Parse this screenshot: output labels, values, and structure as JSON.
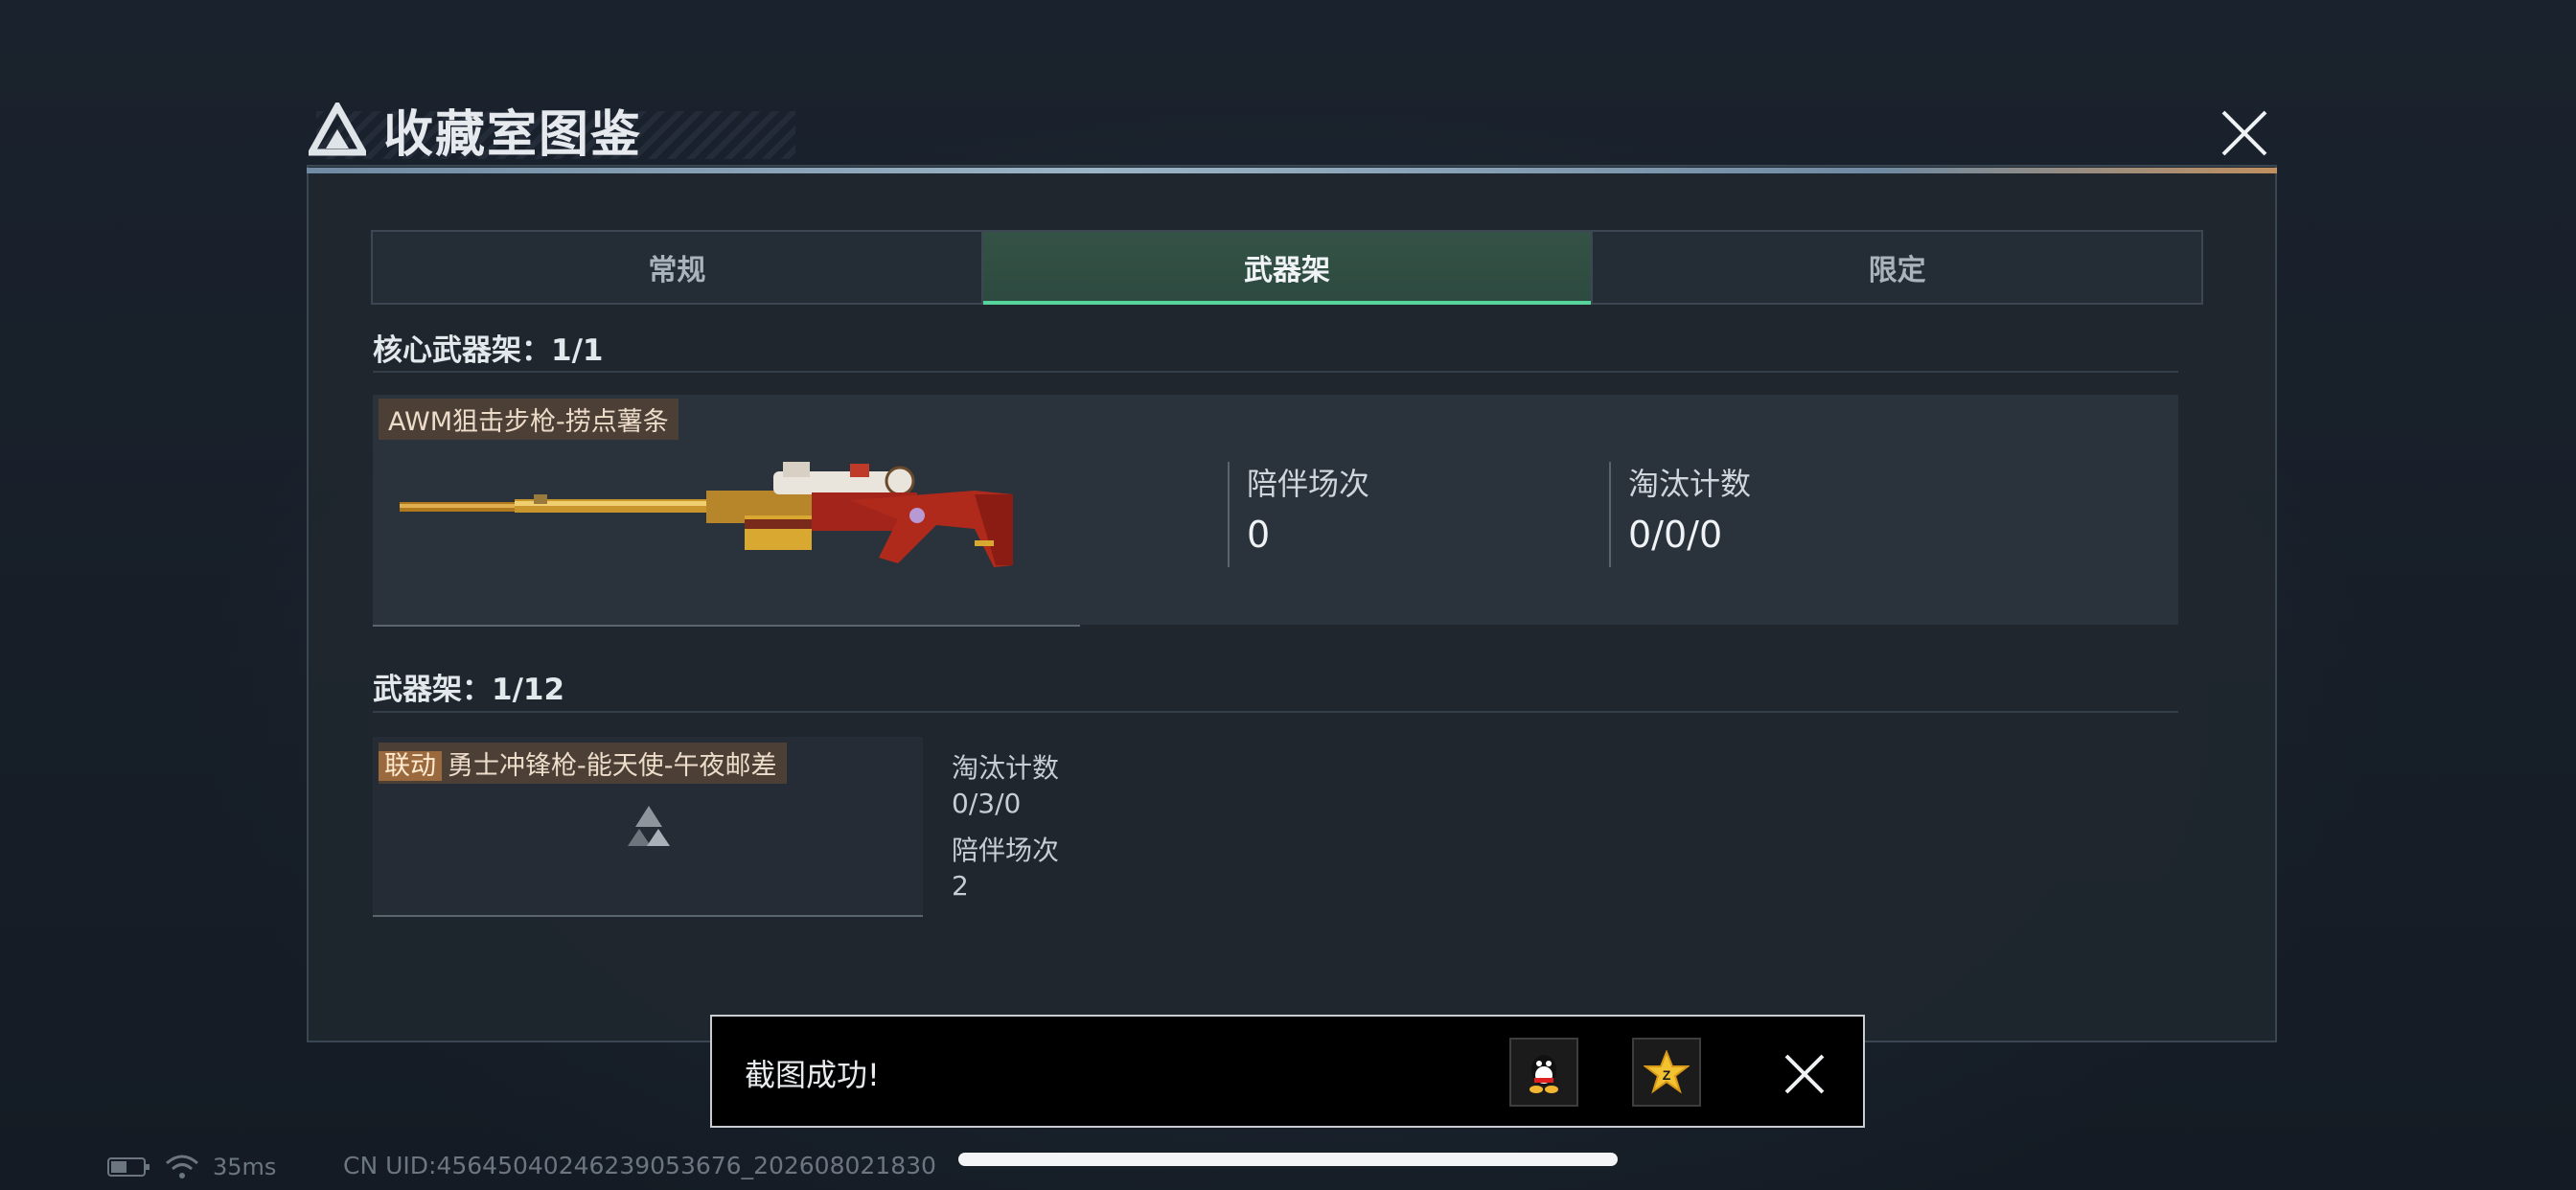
{
  "window": {
    "title": "收藏室图鉴"
  },
  "tabs": [
    {
      "label": "常规",
      "active": false
    },
    {
      "label": "武器架",
      "active": true
    },
    {
      "label": "限定",
      "active": false
    }
  ],
  "core_rack": {
    "title": "核心武器架：1/1",
    "weapon_name": "AWM狙击步枪-捞点薯条",
    "stats": [
      {
        "label": "陪伴场次",
        "value": "0"
      },
      {
        "label": "淘汰计数",
        "value": "0/0/0"
      }
    ]
  },
  "weapon_rack": {
    "title": "武器架：1/12",
    "items": [
      {
        "tag": "联动",
        "name": "勇士冲锋枪-能天使-午夜邮差",
        "kill_label": "淘汰计数",
        "kill_value": "0/3/0",
        "match_label": "陪伴场次",
        "match_value": "2"
      }
    ]
  },
  "toast": {
    "message": "截图成功!",
    "share_targets": [
      "qq-icon",
      "qzone-icon"
    ]
  },
  "status_bar": {
    "ping": "35ms",
    "uid": "CN UID:456450402462390536​76_202608021830"
  },
  "colors": {
    "accent_green": "#56d49c",
    "tag_brown": "#4c4036",
    "collab_orange": "#9a6a3e"
  }
}
